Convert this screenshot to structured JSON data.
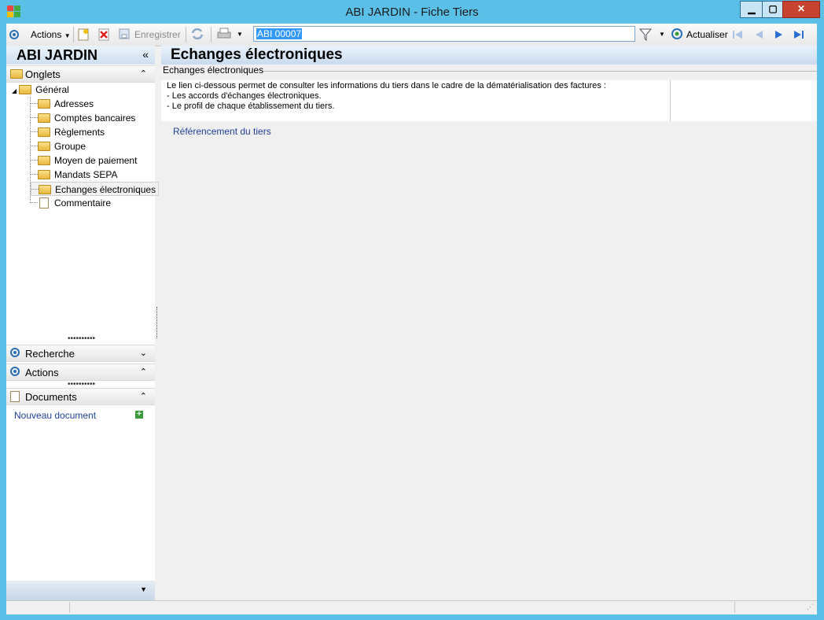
{
  "window": {
    "title": "ABI JARDIN -  Fiche Tiers",
    "minimize": "▁",
    "maximize": "▢",
    "close": "✕"
  },
  "toolbar": {
    "actions_label": "Actions",
    "save_label": "Enregistrer",
    "search_value": "ABI 00007",
    "refresh_label": "Actualiser"
  },
  "left": {
    "title": "ABI JARDIN",
    "collapse": "«",
    "onglets_label": "Onglets",
    "tree_root": "Général",
    "tree_items": [
      "Adresses",
      "Comptes bancaires",
      "Règlements",
      "Groupe",
      "Moyen de paiement",
      "Mandats SEPA",
      "Echanges électroniques",
      "Commentaire"
    ],
    "recherche_label": "Recherche",
    "actions_label": "Actions",
    "documents_label": "Documents",
    "new_document_label": "Nouveau document"
  },
  "main": {
    "title": "Echanges électroniques",
    "group_legend": "Echanges électroniques",
    "info_lines": [
      "Le lien ci-dessous permet de consulter les informations du tiers dans le cadre de la dématérialisation des factures :",
      "- Les accords d'échanges électroniques.",
      "- Le profil de chaque établissement du tiers."
    ],
    "link_label": "Référencement du tiers"
  },
  "icons": {
    "accent": "#2b6fb6",
    "window_frame": "#5bc0e8",
    "link_color": "#1f3f9a"
  }
}
